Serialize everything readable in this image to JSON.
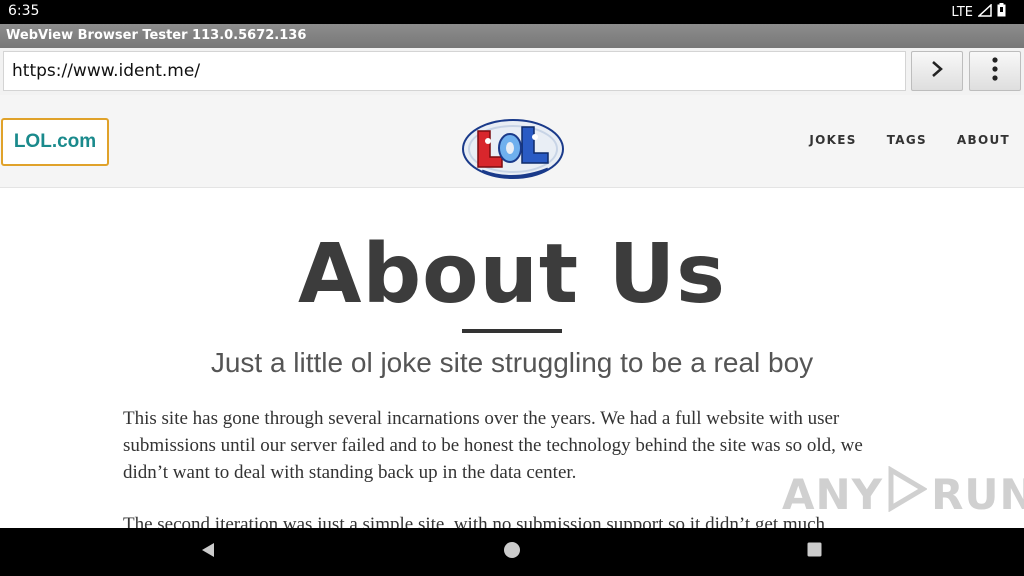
{
  "status": {
    "time": "6:35",
    "network": "LTE"
  },
  "app": {
    "title": "WebView Browser Tester 113.0.5672.136"
  },
  "toolbar": {
    "url": "https://www.ident.me/"
  },
  "site": {
    "brand": "LOL.com",
    "logo_text": "LOL",
    "nav": [
      "JOKES",
      "TAGS",
      "ABOUT"
    ]
  },
  "page": {
    "title": "About Us",
    "subtitle": "Just a little ol joke site struggling to be a real boy",
    "paragraphs": [
      "This site has gone through several incarnations over the years. We had a full website with user submissions until our server failed and to be honest the technology behind the site was so old, we didn’t want to deal with standing back up in the data center.",
      "The second iteration was just a simple site, with no submission support so it didn’t get much"
    ]
  },
  "watermark": {
    "text": "ANY",
    "text2": "RUN"
  },
  "colors": {
    "brand_text": "#1a8a8c",
    "brand_border": "#e0a22a",
    "title": "#3c3c3c"
  }
}
